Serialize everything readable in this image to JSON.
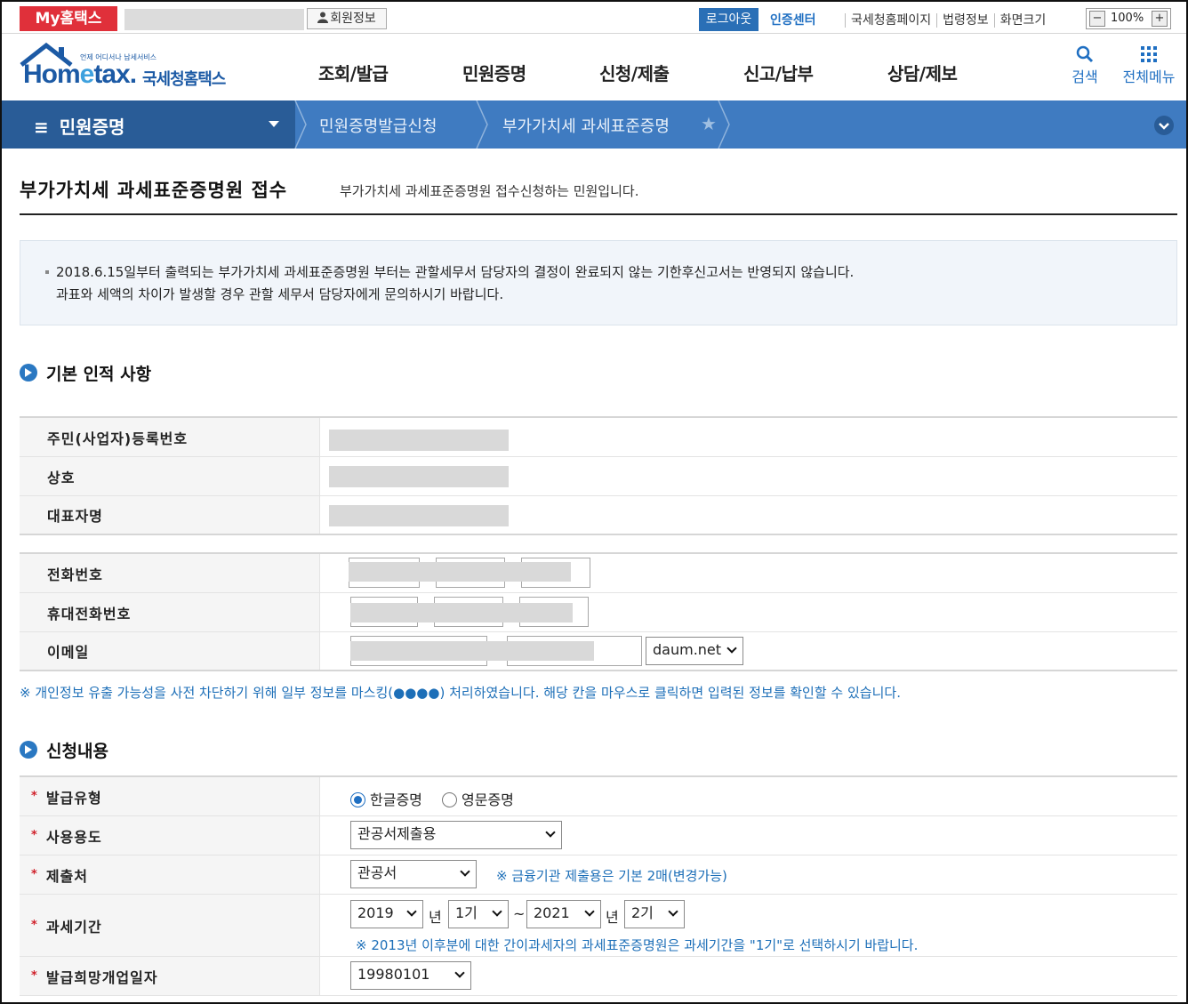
{
  "topbar": {
    "my_hometax": "My홈택스",
    "member_info": "회원정보",
    "logout": "로그아웃",
    "auth_center": "인증센터",
    "links": [
      "국세청홈페이지",
      "법령정보",
      "화면크기"
    ],
    "zoom_level": "100%",
    "zoom_minus": "−",
    "zoom_plus": "+"
  },
  "header": {
    "logo_tiny": "언제 어디서나 납세서비스",
    "logo_main_a": "Hom",
    "logo_main_e": "e",
    "logo_main_b": "tax.",
    "logo_sub": "국세청홈택스",
    "nav": [
      "조회/발급",
      "민원증명",
      "신청/제출",
      "신고/납부",
      "상담/제보"
    ],
    "search": "검색",
    "all_menu": "전체메뉴"
  },
  "breadcrumb": {
    "menu": "민원증명",
    "items": [
      "민원증명발급신청",
      "부가가치세 과세표준증명"
    ]
  },
  "page": {
    "title": "부가가치세 과세표준증명원 접수",
    "description": "부가가치세 과세표준증명원 접수신청하는 민원입니다."
  },
  "notice": {
    "line1": "2018.6.15일부터 출력되는 부가가치세 과세표준증명원 부터는 관할세무서 담당자의 결정이 완료되지 않는 기한후신고서는 반영되지 않습니다.",
    "line2": "과표와 세액의 차이가 발생할 경우 관할 세무서 담당자에게 문의하시기 바랍니다."
  },
  "basic": {
    "heading": "기본 인적 사항",
    "labels": [
      "주민(사업자)등록번호",
      "상호",
      "대표자명"
    ],
    "contact_labels": [
      "전화번호",
      "휴대전화번호",
      "이메일"
    ],
    "email_domain": "daum.net",
    "mask_note": "※ 개인정보 유출 가능성을 사전 차단하기 위해 일부 정보를 마스킹(●●●●) 처리하였습니다. 해당 칸을 마우스로 클릭하면 입력된 정보를 확인할 수 있습니다."
  },
  "request": {
    "heading": "신청내용",
    "required_mark": "*",
    "issue_type_label": "발급유형",
    "issue_type_options": [
      "한글증명",
      "영문증명"
    ],
    "issue_type_selected": "한글증명",
    "usage_label": "사용용도",
    "usage_value": "관공서제출용",
    "submit_to_label": "제출처",
    "submit_to_value": "관공서",
    "submit_to_hint": "※ 금융기관 제출용은 기본 2매(변경가능)",
    "period_label": "과세기간",
    "period_from_year": "2019",
    "period_from_term": "1기",
    "period_to_year": "2021",
    "period_to_term": "2기",
    "year_unit": "년",
    "tilde": "~",
    "period_hint": "※ 2013년 이후분에 대한 간이과세자의 과세표준증명원은 과세기간을 \"1기\"로 선택하시기 바랍니다.",
    "open_date_label": "발급희망개업일자",
    "open_date_value": "19980101"
  }
}
